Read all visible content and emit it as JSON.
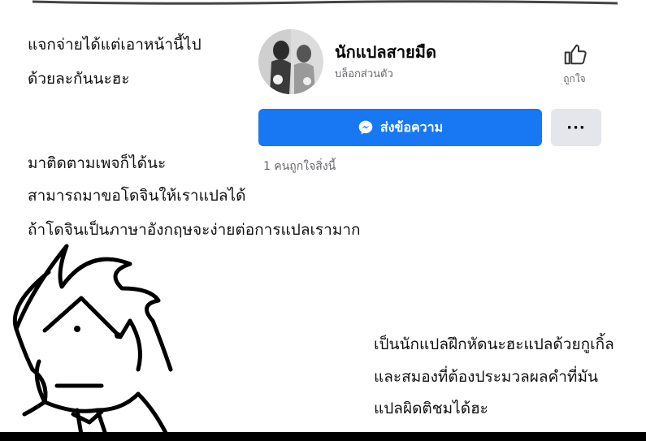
{
  "captions": {
    "top_left_line1": "แจกจ่ายได้แต่เอาหน้านี้ไป",
    "top_left_line2": "ด้วยละกันนะฮะ",
    "middle_line1": "มาติดตามเพจก็ได้นะ",
    "middle_line2": "สามารถมาขอโดจินให้เราแปลได้",
    "middle_line3": "ถ้าโดจินเป็นภาษาอังกฤษจะง่ายต่อการแปลเรามาก",
    "bottom_right_line1": "เป็นนักแปลฝึกหัดนะฮะแปลด้วยกูเกิ้ล",
    "bottom_right_line2": "และสมองที่ต้องประมวลผลคำที่มัน",
    "bottom_right_line3": "แปลผิดติชมได้ฮะ"
  },
  "page": {
    "name": "นักแปลสายมืด",
    "category": "บล็อกส่วนตัว",
    "like_label": "ถูกใจ",
    "message_button": "ส่งข้อความ",
    "more_button": "···",
    "likes_text": "1 คนถูกใจสิ่งนี้"
  },
  "icons": {
    "like": "thumbs-up-icon",
    "messenger": "messenger-icon",
    "more": "more-icon"
  },
  "colors": {
    "primary": "#1877f2",
    "secondary_button": "#e4e6eb",
    "muted_text": "#65676b"
  }
}
